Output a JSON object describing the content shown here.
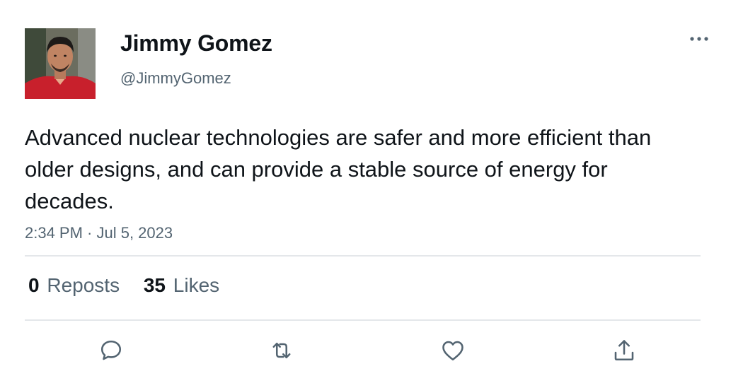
{
  "author": {
    "name": "Jimmy Gomez",
    "handle": "@JimmyGomez"
  },
  "tweet": {
    "text": "Advanced nuclear technologies are safer and more efficient than older designs, and can provide a stable source of energy for decades.",
    "timestamp": "2:34 PM · Jul 5, 2023"
  },
  "stats": {
    "reposts_count": "0",
    "reposts_label": "Reposts",
    "likes_count": "35",
    "likes_label": "Likes"
  },
  "icons": {
    "more": "more-horizontal-icon",
    "reply": "reply-icon",
    "repost": "repost-icon",
    "like": "heart-icon",
    "share": "share-icon"
  },
  "colors": {
    "text": "#0f1419",
    "secondary": "#536471",
    "divider": "#e4e7ea"
  }
}
